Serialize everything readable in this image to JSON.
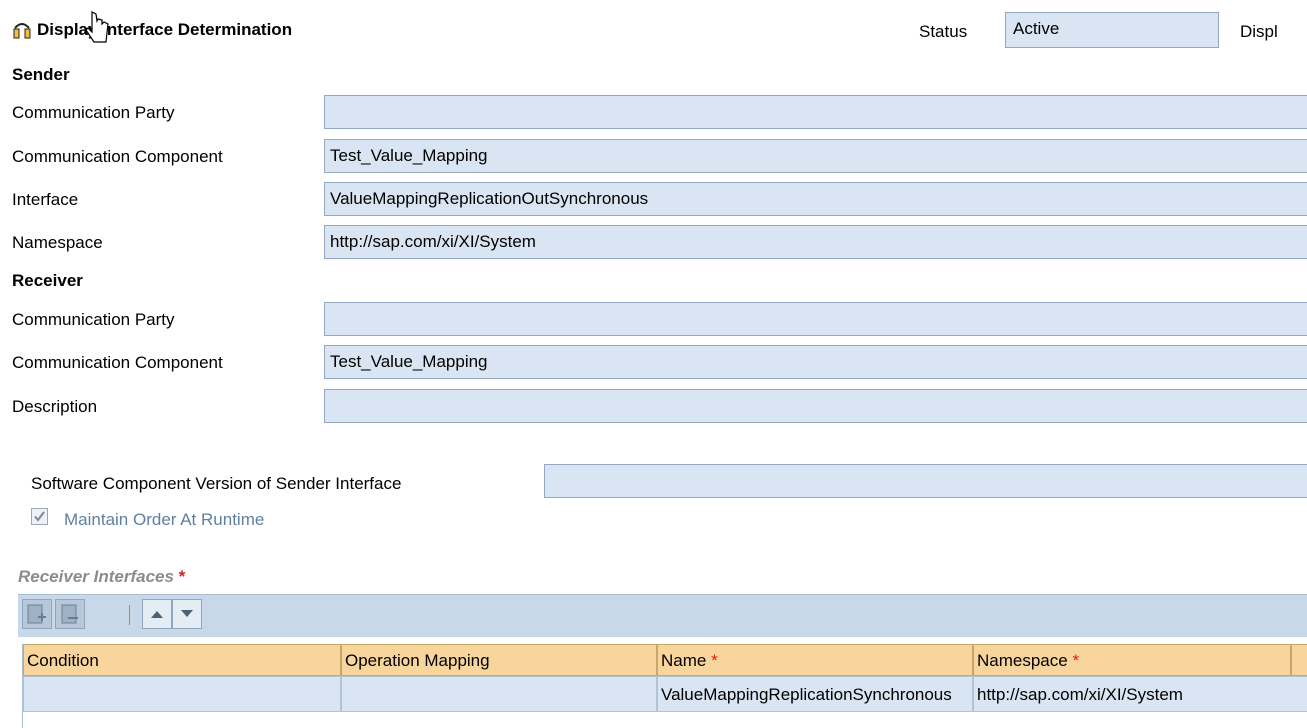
{
  "header": {
    "title": "Display Interface Determination",
    "status_label": "Status",
    "status_value": "Active",
    "display_truncated": "Displ"
  },
  "sender": {
    "heading": "Sender",
    "rows": [
      {
        "label": "Communication Party",
        "value": ""
      },
      {
        "label": "Communication Component",
        "value": "Test_Value_Mapping"
      },
      {
        "label": "Interface",
        "value": "ValueMappingReplicationOutSynchronous"
      },
      {
        "label": "Namespace",
        "value": "http://sap.com/xi/XI/System"
      }
    ]
  },
  "receiver": {
    "heading": "Receiver",
    "rows": [
      {
        "label": "Communication Party",
        "value": ""
      },
      {
        "label": "Communication Component",
        "value": "Test_Value_Mapping"
      },
      {
        "label": "Description",
        "value": ""
      }
    ]
  },
  "software_component": {
    "label": "Software Component Version of Sender Interface",
    "value": ""
  },
  "maintain_order": {
    "label": "Maintain Order At Runtime",
    "checked": true
  },
  "receiver_interfaces": {
    "title": "Receiver Interfaces",
    "required_mark": "*",
    "toolbar": {
      "icons": [
        "insert-row-icon",
        "delete-row-icon",
        "move-up-icon",
        "move-down-icon"
      ]
    },
    "columns": [
      {
        "label": "Condition",
        "required": ""
      },
      {
        "label": "Operation Mapping",
        "required": ""
      },
      {
        "label": "Name",
        "required": "*"
      },
      {
        "label": "Namespace",
        "required": "*"
      }
    ],
    "rows": [
      {
        "condition": "",
        "operation_mapping": "",
        "name": "ValueMappingReplicationSynchronous",
        "namespace": "http://sap.com/xi/XI/System"
      }
    ]
  }
}
